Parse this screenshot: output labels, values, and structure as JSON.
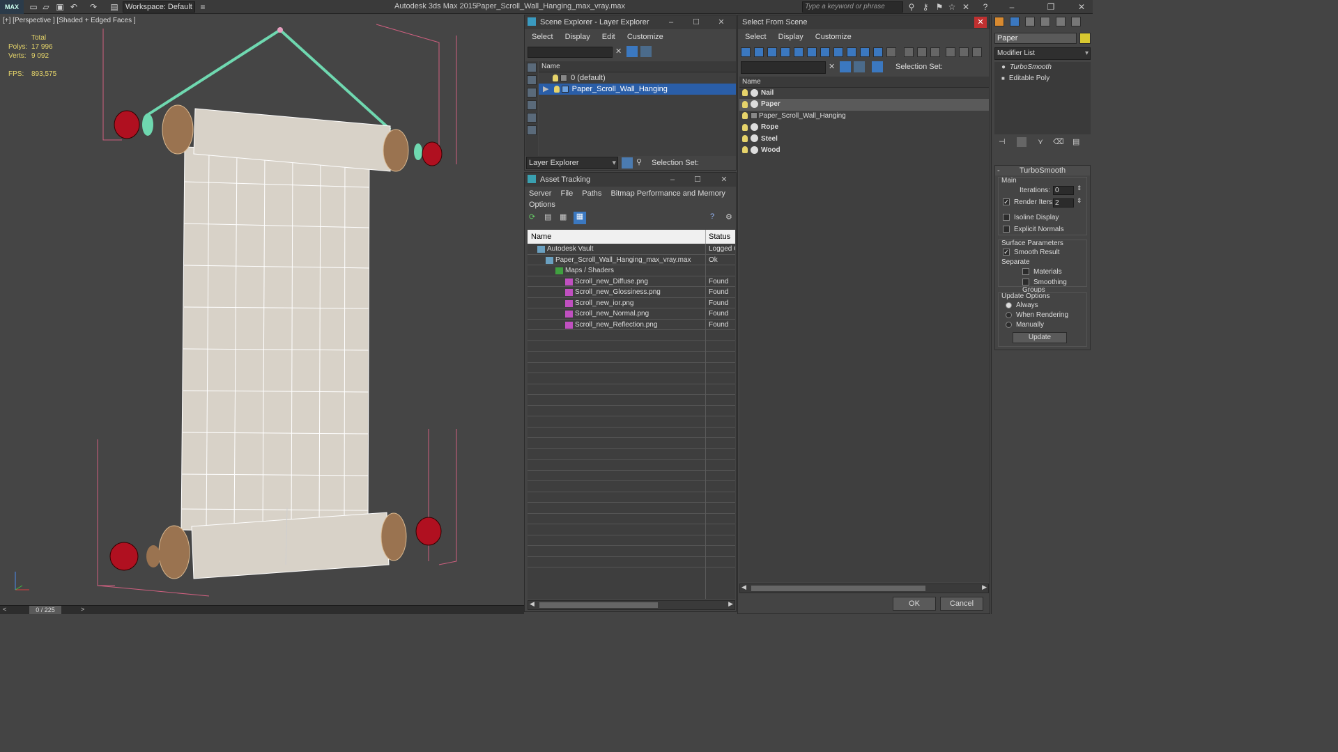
{
  "topbar": {
    "logo": "MAX",
    "workspace": "Workspace: Default",
    "app_title": "Autodesk 3ds Max  2015",
    "file_title": "Paper_Scroll_Wall_Hanging_max_vray.max",
    "search_placeholder": "Type a keyword or phrase"
  },
  "viewport": {
    "label": "[+] [Perspective ] [Shaded + Edged Faces ]",
    "stats": {
      "total_label": "Total",
      "polys_label": "Polys:",
      "polys": "17 996",
      "verts_label": "Verts:",
      "verts": "9 092",
      "fps_label": "FPS:",
      "fps": "893,575"
    },
    "timeline": {
      "frame": "0 / 225",
      "prev": "<",
      "next": ">"
    }
  },
  "scene_explorer": {
    "title": "Scene Explorer - Layer Explorer",
    "menu": [
      "Select",
      "Display",
      "Edit",
      "Customize"
    ],
    "column": "Name",
    "rows": [
      "0 (default)",
      "Paper_Scroll_Wall_Hanging"
    ],
    "footer_label": "Layer Explorer",
    "selection_set_label": "Selection Set:"
  },
  "asset_tracking": {
    "title": "Asset Tracking",
    "menu": [
      "Server",
      "File",
      "Paths",
      "Bitmap Performance and Memory",
      "Options"
    ],
    "columns": [
      "Name",
      "Status"
    ],
    "rows": [
      {
        "name": "Autodesk Vault",
        "status": "Logged O"
      },
      {
        "name": "Paper_Scroll_Wall_Hanging_max_vray.max",
        "status": "Ok"
      },
      {
        "name": "Maps / Shaders",
        "status": ""
      },
      {
        "name": "Scroll_new_Diffuse.png",
        "status": "Found"
      },
      {
        "name": "Scroll_new_Glossiness.png",
        "status": "Found"
      },
      {
        "name": "Scroll_new_ior.png",
        "status": "Found"
      },
      {
        "name": "Scroll_new_Normal.png",
        "status": "Found"
      },
      {
        "name": "Scroll_new_Reflection.png",
        "status": "Found"
      }
    ]
  },
  "select_from_scene": {
    "title": "Select From Scene",
    "menu": [
      "Select",
      "Display",
      "Customize"
    ],
    "selection_set_label": "Selection Set:",
    "column": "Name",
    "rows": [
      "Nail",
      "Paper",
      "Paper_Scroll_Wall_Hanging",
      "Rope",
      "Steel",
      "Wood"
    ],
    "ok": "OK",
    "cancel": "Cancel"
  },
  "modifier_panel": {
    "object_name": "Paper",
    "modifier_list": "Modifier List",
    "stack": [
      "TurboSmooth",
      "Editable Poly"
    ],
    "rollout_title": "TurboSmooth",
    "main_label": "Main",
    "iterations_label": "Iterations:",
    "iterations": "0",
    "render_iters_label": "Render Iters:",
    "render_iters": "2",
    "isoline": "Isoline Display",
    "explicit": "Explicit Normals",
    "surface_params": "Surface Parameters",
    "smooth_result": "Smooth Result",
    "separate": "Separate",
    "materials": "Materials",
    "smoothing_groups": "Smoothing Groups",
    "update_options": "Update Options",
    "always": "Always",
    "when_rendering": "When Rendering",
    "manually": "Manually",
    "update": "Update"
  }
}
